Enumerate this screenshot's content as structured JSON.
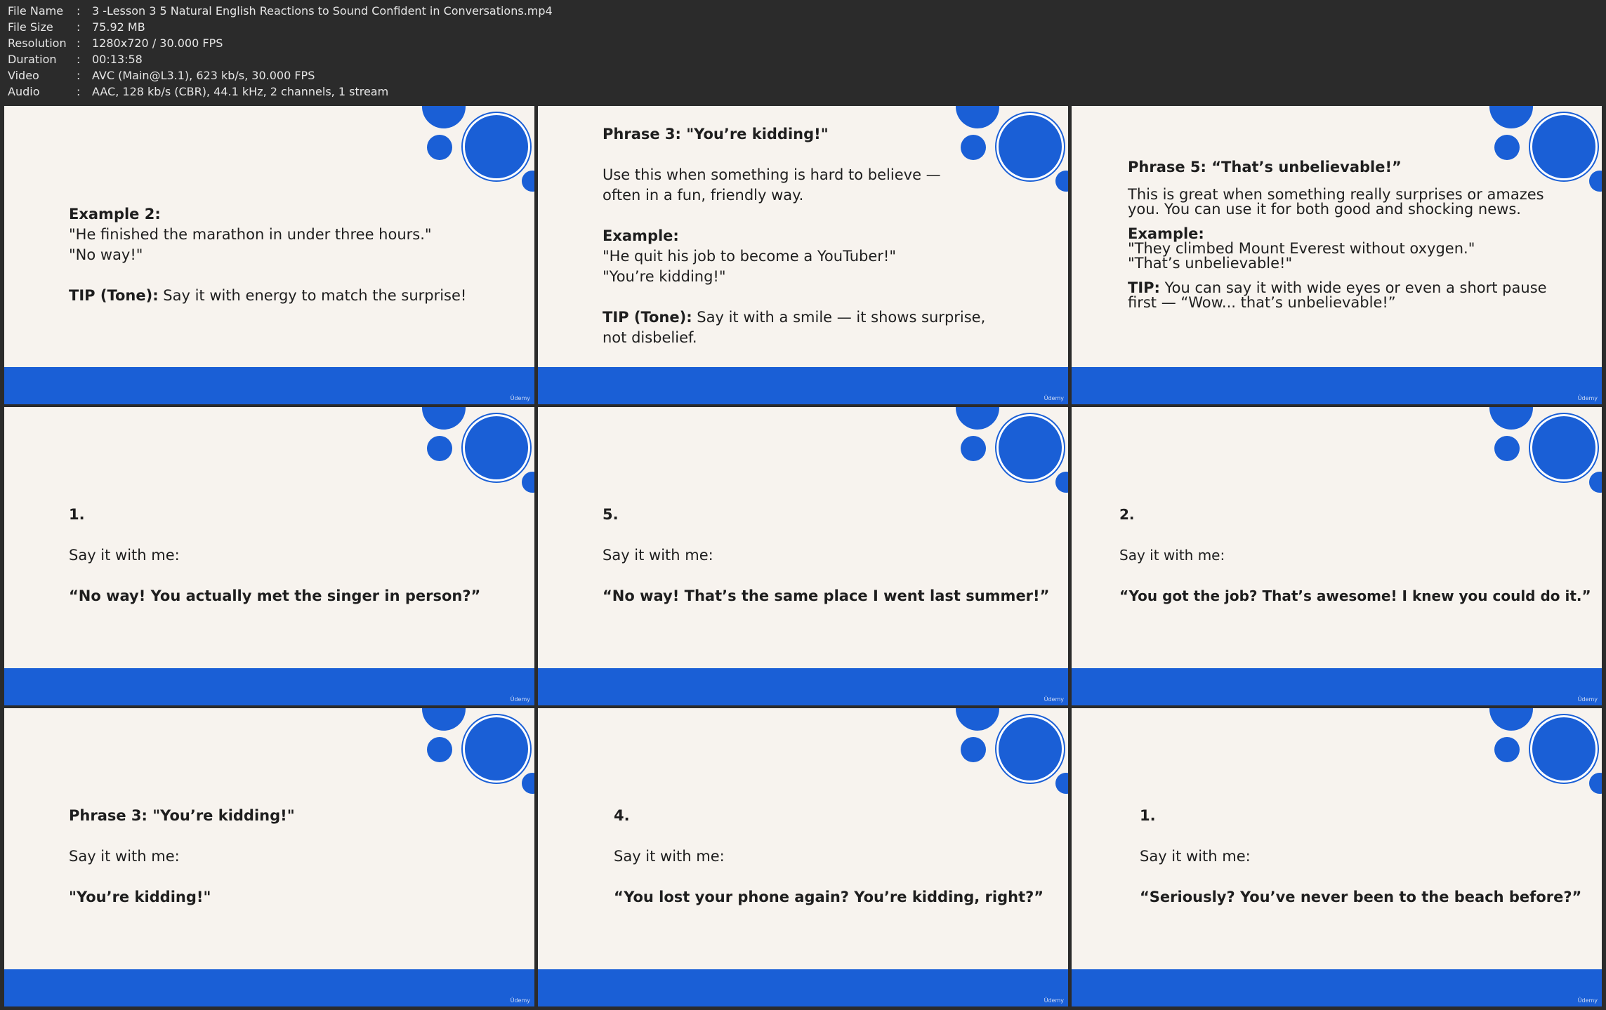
{
  "metadata": {
    "rows": [
      {
        "key": "File Name",
        "value": "3 -Lesson 3 5 Natural English Reactions to Sound Confident in Conversations.mp4"
      },
      {
        "key": "File Size",
        "value": "75.92 MB"
      },
      {
        "key": "Resolution",
        "value": "1280x720 / 30.000 FPS"
      },
      {
        "key": "Duration",
        "value": "00:13:58"
      },
      {
        "key": "Video",
        "value": "AVC (Main@L3.1), 623 kb/s, 30.000 FPS"
      },
      {
        "key": "Audio",
        "value": "AAC, 128 kb/s (CBR), 44.1 kHz, 2 channels, 1 stream"
      }
    ]
  },
  "colors": {
    "accent": "#1a5fd6",
    "slide_bg": "#f7f3ee",
    "header_bg": "#2b2b2b"
  },
  "brand": "Ûdemy",
  "frames": [
    {
      "lines": [
        {
          "bold": "Example 2:",
          "text": ""
        },
        {
          "bold": "",
          "text": "\"He finished the marathon in under three hours.\""
        },
        {
          "bold": "",
          "text": "\"No way!\""
        },
        {
          "bold": "TIP (Tone):",
          "text": " Say it with energy to match the surprise!"
        }
      ]
    },
    {
      "lines": [
        {
          "bold": "Phrase 3: \"You’re kidding!\"",
          "text": ""
        },
        {
          "bold": "",
          "text": "Use this when something is hard to believe —"
        },
        {
          "bold": "",
          "text": "often in a fun, friendly way."
        },
        {
          "bold": "Example:",
          "text": ""
        },
        {
          "bold": "",
          "text": "\"He quit his job to become a YouTuber!\""
        },
        {
          "bold": "",
          "text": "\"You’re kidding!\""
        },
        {
          "bold": "TIP (Tone):",
          "text": " Say it with a smile — it shows surprise,"
        },
        {
          "bold": "",
          "text": "not disbelief."
        }
      ]
    },
    {
      "lines": [
        {
          "bold": "Phrase 5: “That’s unbelievable!”",
          "text": ""
        },
        {
          "bold": "",
          "text": "This is great when something really surprises or amazes"
        },
        {
          "bold": "",
          "text": "you. You can use it for both good and shocking news."
        },
        {
          "bold": "Example:",
          "text": ""
        },
        {
          "bold": "",
          "text": "\"They climbed Mount Everest without oxygen.\""
        },
        {
          "bold": "",
          "text": "\"That’s unbelievable!\""
        },
        {
          "bold": "TIP:",
          "text": " You can say it with wide eyes or even a short pause"
        },
        {
          "bold": "",
          "text": "first — “Wow... that’s unbelievable!”"
        }
      ]
    },
    {
      "number": "1.",
      "say": "Say it with me:",
      "quote": "“No way! You actually met the singer in person?”"
    },
    {
      "number": "5.",
      "say": "Say it with me:",
      "quote": "“No way! That’s the same place I went last summer!”"
    },
    {
      "number": "2.",
      "say": "Say it with me:",
      "quote": "“You got the job? That’s awesome! I knew you could do it.”"
    },
    {
      "number": "Phrase 3: \"You’re kidding!\"",
      "say": "Say it with me:",
      "quote": "\"You’re kidding!\""
    },
    {
      "number": "4.",
      "say": "Say it with me:",
      "quote": "“You lost your phone again? You’re kidding, right?”"
    },
    {
      "number": "1.",
      "say": "Say it with me:",
      "quote": "“Seriously? You’ve never been to the beach before?”"
    }
  ]
}
